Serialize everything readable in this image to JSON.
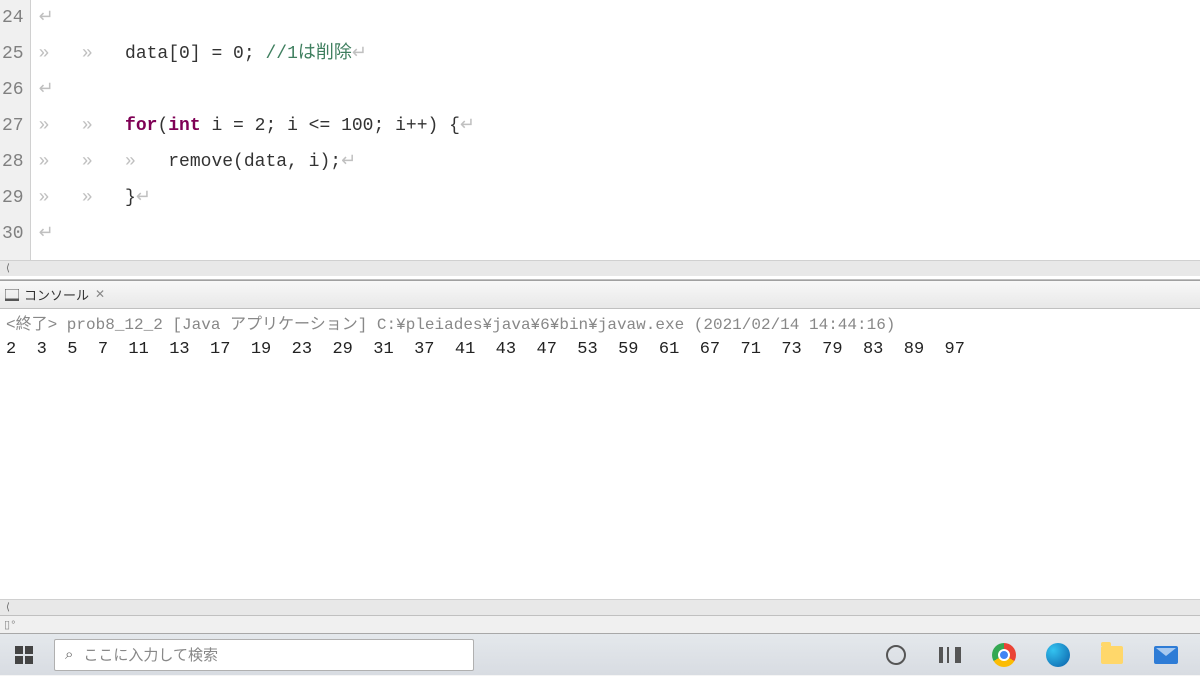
{
  "editor": {
    "lines": [
      {
        "num": "24",
        "indent": "",
        "code_html": "<span class='eol'>↵</span>"
      },
      {
        "num": "25",
        "indent": "»   »   ",
        "code_html": "data[0] = 0; <span class='comment'>//1は削除</span><span class='eol'>↵</span>"
      },
      {
        "num": "26",
        "indent": "",
        "code_html": "<span class='eol'>↵</span>"
      },
      {
        "num": "27",
        "indent": "»   »   ",
        "code_html": "<span class='kw'>for</span>(<span class='kw'>int</span> i = 2; i <= 100; i++) {<span class='eol'>↵</span>"
      },
      {
        "num": "28",
        "indent": "»   »   »   ",
        "code_html": "remove(data, i);<span class='eol'>↵</span>"
      },
      {
        "num": "29",
        "indent": "»   »   ",
        "code_html": "}<span class='eol'>↵</span>"
      },
      {
        "num": "30",
        "indent": "",
        "code_html": "<span class='eol'>↵</span>"
      }
    ]
  },
  "console": {
    "tab_label": "コンソール",
    "header": "<終了> prob8_12_2 [Java アプリケーション] C:¥pleiades¥java¥6¥bin¥javaw.exe (2021/02/14 14:44:16)",
    "output": "2  3  5  7  11  13  17  19  23  29  31  37  41  43  47  53  59  61  67  71  73  79  83  89  97"
  },
  "taskbar": {
    "search_placeholder": "ここに入力して検索"
  }
}
